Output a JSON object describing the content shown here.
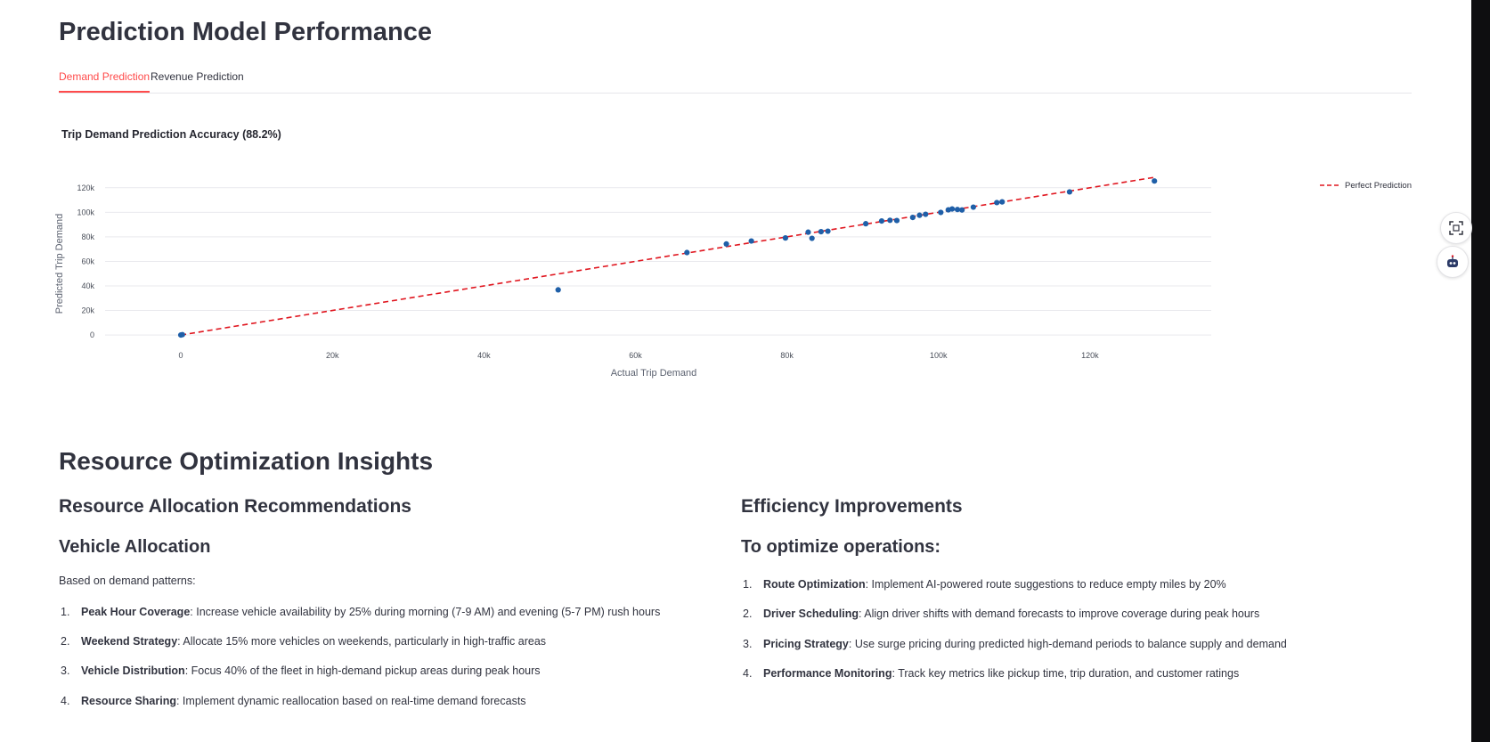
{
  "page": {
    "title": "Prediction Model Performance"
  },
  "tabs": [
    {
      "label": "Demand Prediction",
      "active": true
    },
    {
      "label": "Revenue Prediction",
      "active": false
    }
  ],
  "chart_data": {
    "type": "scatter",
    "title": "Trip Demand Prediction Accuracy (88.2%)",
    "xlabel": "Actual Trip Demand",
    "ylabel": "Predicted Trip Demand",
    "xlim": [
      -10000,
      136000
    ],
    "ylim": [
      -5000,
      130000
    ],
    "x_ticks": [
      0,
      20000,
      40000,
      60000,
      80000,
      100000,
      120000
    ],
    "x_tick_labels": [
      "0",
      "20k",
      "40k",
      "60k",
      "80k",
      "100k",
      "120k"
    ],
    "y_ticks": [
      0,
      20000,
      40000,
      60000,
      80000,
      100000,
      120000
    ],
    "y_tick_labels": [
      "0",
      "20k",
      "40k",
      "60k",
      "80k",
      "100k",
      "120k"
    ],
    "grid": true,
    "legend_position": "top-right",
    "series": [
      {
        "name": "",
        "kind": "points",
        "color": "#1f5fa8",
        "x": [
          0,
          200,
          49800,
          66800,
          72000,
          75300,
          79800,
          82800,
          83300,
          84500,
          85400,
          90400,
          92500,
          93600,
          94500,
          96600,
          97500,
          98300,
          100300,
          101300,
          101800,
          102500,
          103100,
          104600,
          107700,
          108400,
          117300,
          128500
        ],
        "y": [
          0,
          300,
          36800,
          67200,
          74200,
          76600,
          79100,
          83800,
          78800,
          84200,
          84600,
          90700,
          92900,
          93500,
          93300,
          95800,
          97600,
          98400,
          99900,
          102000,
          102700,
          102300,
          101900,
          104200,
          107900,
          108500,
          116600,
          125500
        ]
      },
      {
        "name": "Perfect Prediction",
        "kind": "line",
        "color": "#e0161f",
        "dash": "dashed",
        "x": [
          0,
          128500
        ],
        "y": [
          0,
          128500
        ]
      }
    ]
  },
  "insights": {
    "title": "Resource Optimization Insights",
    "left": {
      "heading": "Resource Allocation Recommendations",
      "subheading": "Vehicle Allocation",
      "intro": "Based on demand patterns:",
      "items": [
        {
          "num": "1.",
          "bold": "Peak Hour Coverage",
          "text": ": Increase vehicle availability by 25% during morning (7-9 AM) and evening (5-7 PM) rush hours"
        },
        {
          "num": "2.",
          "bold": "Weekend Strategy",
          "text": ": Allocate 15% more vehicles on weekends, particularly in high-traffic areas"
        },
        {
          "num": "3.",
          "bold": "Vehicle Distribution",
          "text": ": Focus 40% of the fleet in high-demand pickup areas during peak hours"
        },
        {
          "num": "4.",
          "bold": "Resource Sharing",
          "text": ": Implement dynamic reallocation based on real-time demand forecasts"
        }
      ]
    },
    "right": {
      "heading": "Efficiency Improvements",
      "subheading": "To optimize operations:",
      "items": [
        {
          "num": "1.",
          "bold": "Route Optimization",
          "text": ": Implement AI-powered route suggestions to reduce empty miles by 20%"
        },
        {
          "num": "2.",
          "bold": "Driver Scheduling",
          "text": ": Align driver shifts with demand forecasts to improve coverage during peak hours"
        },
        {
          "num": "3.",
          "bold": "Pricing Strategy",
          "text": ": Use surge pricing during predicted high-demand periods to balance supply and demand"
        },
        {
          "num": "4.",
          "bold": "Performance Monitoring",
          "text": ": Track key metrics like pickup time, trip duration, and customer ratings"
        }
      ]
    }
  },
  "colors": {
    "accent": "#ff4b4b",
    "text": "#31333f",
    "point": "#1f5fa8",
    "reference_line": "#e0161f"
  },
  "side_buttons": [
    {
      "icon": "screenshot-select-icon"
    },
    {
      "icon": "assistant-robot-icon"
    }
  ]
}
